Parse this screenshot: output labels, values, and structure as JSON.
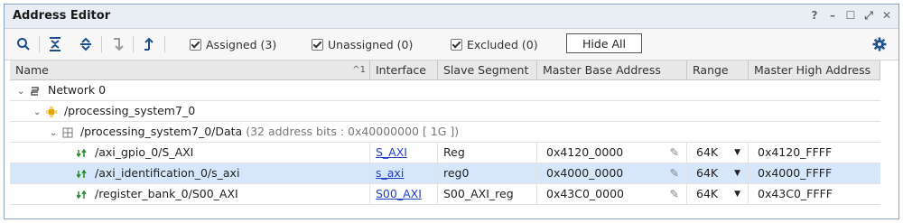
{
  "window": {
    "title": "Address Editor"
  },
  "window_controls": [
    "?",
    "–",
    "☐",
    "⤢",
    "✕"
  ],
  "toolbar": {
    "checkboxes": [
      {
        "label": "Assigned (3)",
        "checked": true
      },
      {
        "label": "Unassigned (0)",
        "checked": true
      },
      {
        "label": "Excluded (0)",
        "checked": true
      }
    ],
    "hide_all_label": "Hide All",
    "icons": [
      "search-icon",
      "collapse-all-icon",
      "expand-all-icon",
      "auto-assign-icon",
      "assign-icon",
      "settings-gear-icon"
    ]
  },
  "columns": {
    "name": "Name",
    "sort_indicator": "^1",
    "interface": "Interface",
    "slave_segment": "Slave Segment",
    "master_base": "Master Base Address",
    "range": "Range",
    "master_high": "Master High Address"
  },
  "tree": {
    "network": "Network 0",
    "processor": "/processing_system7_0",
    "address_space": "/processing_system7_0/Data",
    "address_space_info": "(32 address bits : 0x40000000 [ 1G ])"
  },
  "rows": [
    {
      "name": "/axi_gpio_0/S_AXI",
      "interface": "S_AXI",
      "segment": "Reg",
      "base": "0x4120_0000",
      "range": "64K",
      "high": "0x4120_FFFF"
    },
    {
      "name": "/axi_identification_0/s_axi",
      "interface": "s_axi",
      "segment": "reg0",
      "base": "0x4000_0000",
      "range": "64K",
      "high": "0x4000_FFFF"
    },
    {
      "name": "/register_bank_0/S00_AXI",
      "interface": "S00_AXI",
      "segment": "S00_AXI_reg",
      "base": "0x43C0_0000",
      "range": "64K",
      "high": "0x43C0_FFFF"
    }
  ],
  "selected_row": 1,
  "colors": {
    "accent": "#1f3fc8",
    "selection": "#d6e6fb",
    "title_bg": "#e9edf4"
  }
}
